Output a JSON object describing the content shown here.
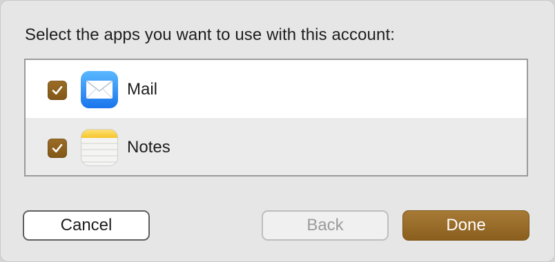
{
  "dialog": {
    "prompt": "Select the apps you want to use with this account:"
  },
  "apps": [
    {
      "label": "Mail",
      "icon": "mail-app-icon",
      "checked": true
    },
    {
      "label": "Notes",
      "icon": "notes-app-icon",
      "checked": true
    }
  ],
  "buttons": {
    "cancel_label": "Cancel",
    "back_label": "Back",
    "back_enabled": false,
    "done_label": "Done"
  },
  "colors": {
    "accent": "#8b5e1e",
    "list_border": "#9a9a9a",
    "dialog_background": "#e6e6e6"
  }
}
